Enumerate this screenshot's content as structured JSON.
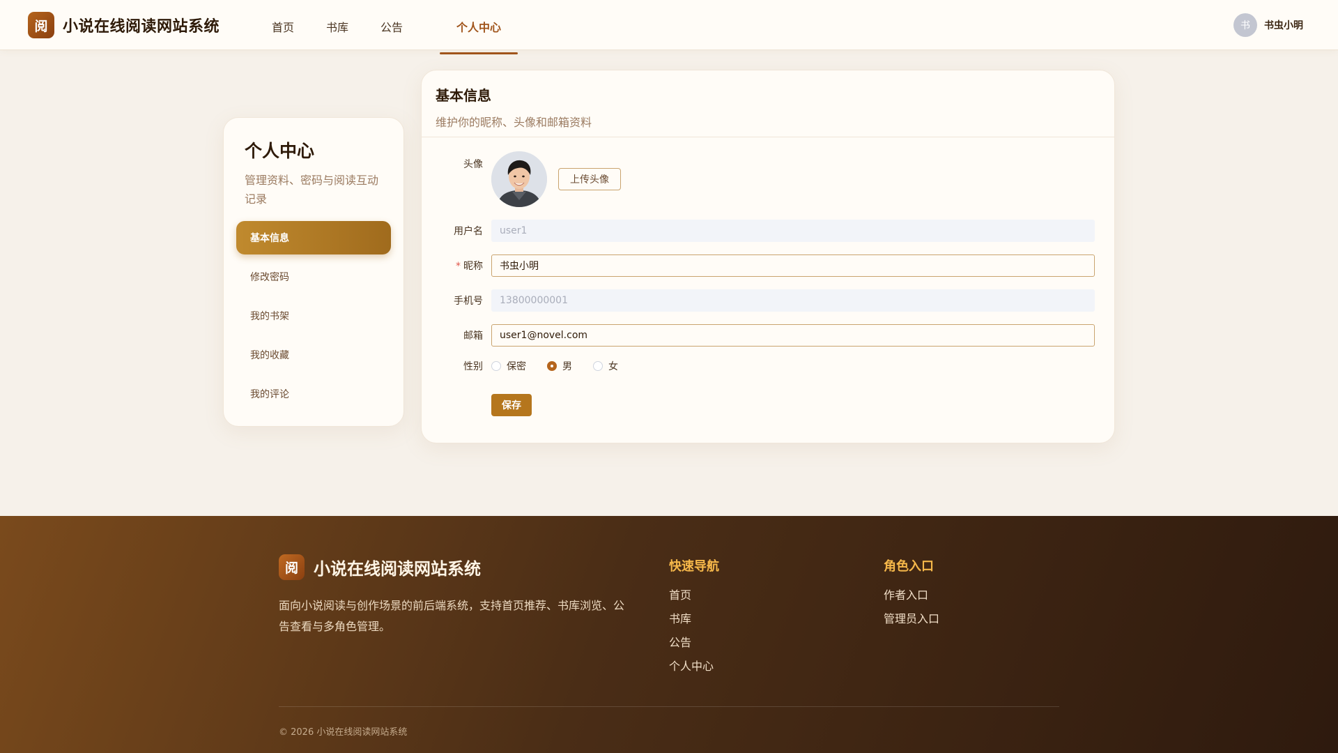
{
  "header": {
    "logo_char": "阅",
    "site_title": "小说在线阅读网站系统",
    "nav": [
      {
        "label": "首页"
      },
      {
        "label": "书库"
      },
      {
        "label": "公告"
      },
      {
        "label": "个人中心"
      }
    ],
    "user_avatar_char": "书",
    "user_name": "书虫小明"
  },
  "sidebar": {
    "title": "个人中心",
    "desc": "管理资料、密码与阅读互动记录",
    "items": [
      {
        "label": "基本信息"
      },
      {
        "label": "修改密码"
      },
      {
        "label": "我的书架"
      },
      {
        "label": "我的收藏"
      },
      {
        "label": "我的评论"
      }
    ]
  },
  "profile": {
    "title": "基本信息",
    "subtitle": "维护你的昵称、头像和邮箱资料",
    "avatar_label": "头像",
    "upload_label": "上传头像",
    "username_label": "用户名",
    "username_value": "user1",
    "nickname_label": "昵称",
    "nickname_required_mark": "*",
    "nickname_value": "书虫小明",
    "phone_label": "手机号",
    "phone_value": "13800000001",
    "email_label": "邮箱",
    "email_value": "user1@novel.com",
    "gender_label": "性别",
    "gender_options": [
      "保密",
      "男",
      "女"
    ],
    "gender_selected": "男",
    "save_label": "保存"
  },
  "footer": {
    "logo_char": "阅",
    "site_title": "小说在线阅读网站系统",
    "desc": "面向小说阅读与创作场景的前后端系统，支持首页推荐、书库浏览、公告查看与多角色管理。",
    "quick_nav_title": "快速导航",
    "quick_nav": [
      "首页",
      "书库",
      "公告",
      "个人中心"
    ],
    "roles_title": "角色入口",
    "roles": [
      "作者入口",
      "管理员入口"
    ],
    "copyright": "© 2026 小说在线阅读网站系统"
  },
  "colors": {
    "accent": "#a0541b",
    "button_gold": "#b5761d",
    "footer_title": "#f6b84a"
  }
}
